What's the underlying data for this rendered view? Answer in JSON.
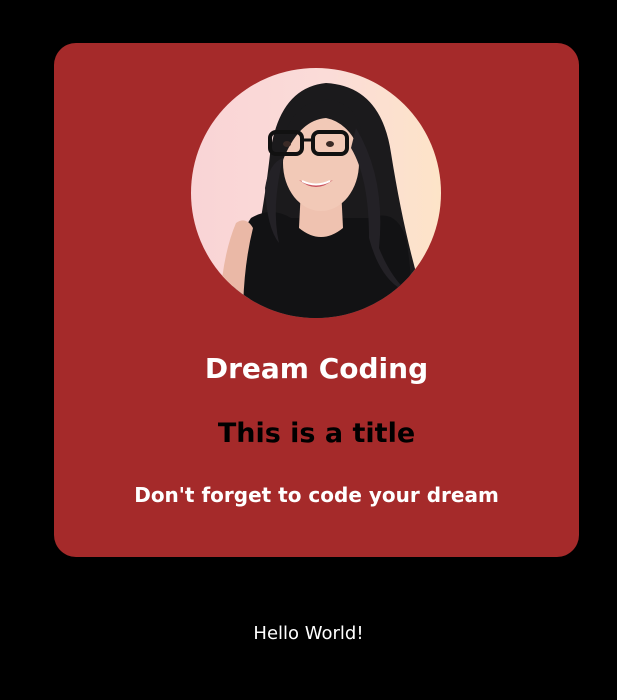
{
  "card": {
    "name": "Dream Coding",
    "title": "This is a title",
    "subtitle": "Don't forget to code your dream",
    "avatar_icon": "profile-photo",
    "background_color": "#a52a2a"
  },
  "footer": {
    "text": "Hello World!"
  },
  "colors": {
    "page_background": "#000000",
    "card_background": "#a52a2a",
    "name_text": "#ffffff",
    "title_text": "#000000",
    "subtitle_text": "#ffffff",
    "footer_text": "#ffffff"
  }
}
